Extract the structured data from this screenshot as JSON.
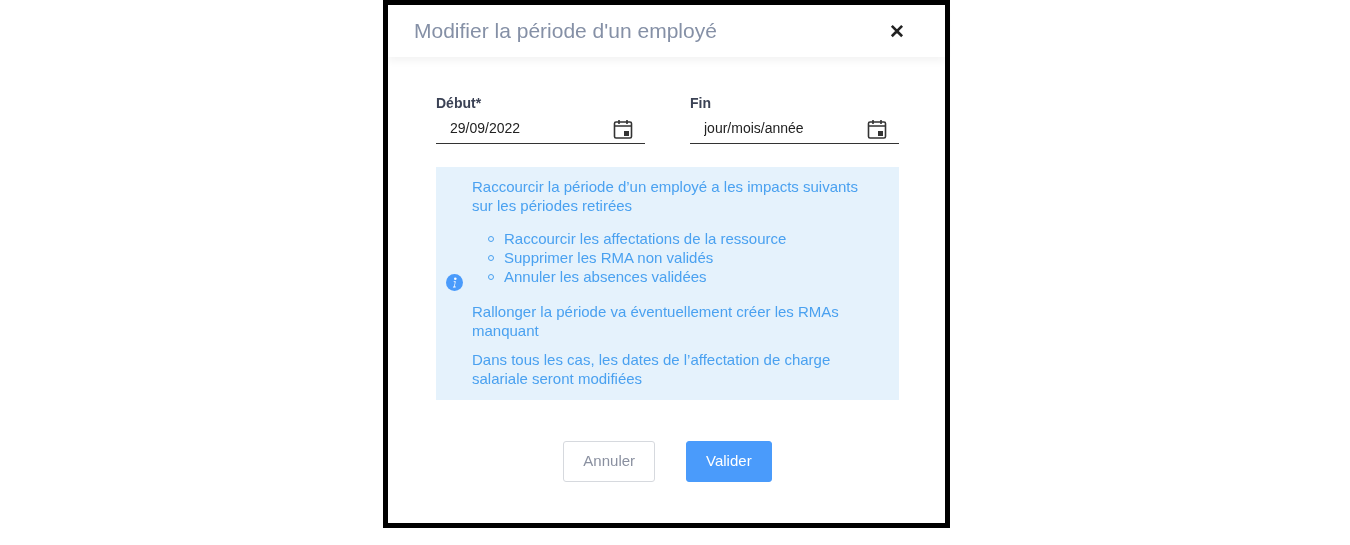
{
  "dialog": {
    "title": "Modifier la période d'un employé",
    "close": "✕"
  },
  "fields": [
    {
      "label": "Début*",
      "value": "29/09/2022"
    },
    {
      "label": "Fin",
      "placeholder": "jour/mois/année"
    }
  ],
  "info": {
    "intro": "Raccourcir la période d’un employé a les impacts suivants sur les périodes retirées",
    "bullets": [
      "Raccourcir les affectations de la ressource",
      "Supprimer les RMA non validés",
      "Annuler les absences validées"
    ],
    "notes": [
      "Rallonger la période va éventuellement créer les RMAs manquant",
      "Dans tous les cas, les dates de l’affectation de charge salariale seront modifiées"
    ]
  },
  "buttons": [
    {
      "label": "Annuler",
      "kind": "secondary"
    },
    {
      "label": "Valider",
      "kind": "primary"
    }
  ]
}
